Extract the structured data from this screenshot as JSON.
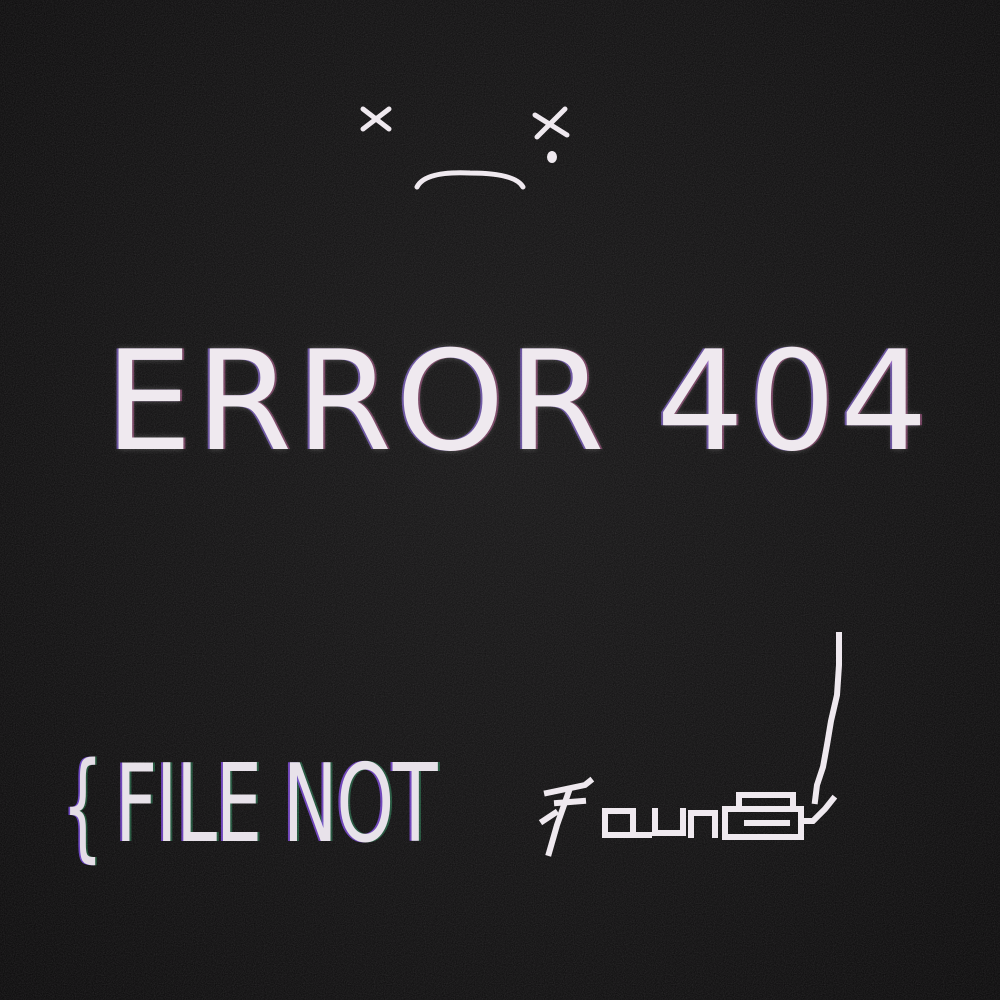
{
  "error": {
    "title": "ERROR 404",
    "subtitle_brace": "{",
    "subtitle_prefix": "FILE NOT",
    "subtitle_suffix_scribbled": "Found"
  },
  "colors": {
    "background": "#0c0b0c",
    "text": "#efe9ef",
    "glitch_purple": "#9a6cff",
    "glitch_green": "#46d28c"
  },
  "icons": {
    "face": "dizzy-sad-face-icon"
  }
}
